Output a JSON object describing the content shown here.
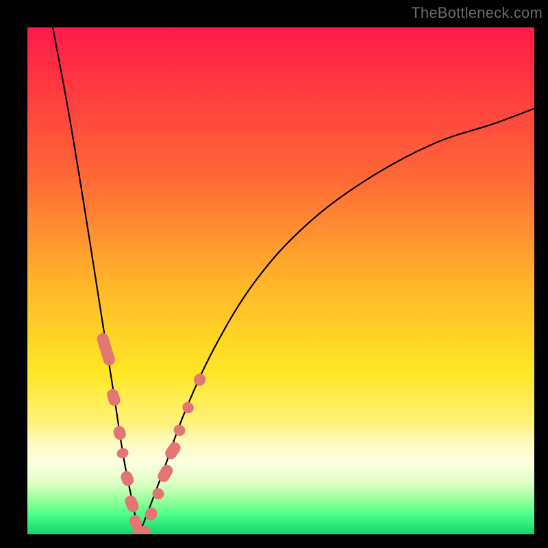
{
  "watermark": "TheBottleneck.com",
  "colors": {
    "curve": "#000000",
    "marker": "#e37575",
    "frame": "#000000"
  },
  "chart_data": {
    "type": "line",
    "title": "",
    "xlabel": "",
    "ylabel": "",
    "xlim": [
      0,
      1
    ],
    "ylim": [
      0,
      1
    ],
    "axes_visible": false,
    "background": "vertical-gradient red→orange→yellow→green",
    "description": "V-shaped bottleneck curve over rainbow gradient; minimum (0 on y) near x≈0.22; pink capsule markers clustered along both arms near the minimum region.",
    "series": [
      {
        "name": "left-arm",
        "x": [
          0.05,
          0.08,
          0.11,
          0.14,
          0.17,
          0.19,
          0.21,
          0.215,
          0.22
        ],
        "y": [
          1.0,
          0.84,
          0.66,
          0.47,
          0.28,
          0.15,
          0.05,
          0.02,
          0.0
        ]
      },
      {
        "name": "right-arm",
        "x": [
          0.22,
          0.24,
          0.27,
          0.31,
          0.37,
          0.45,
          0.55,
          0.67,
          0.8,
          0.92,
          1.0
        ],
        "y": [
          0.0,
          0.05,
          0.13,
          0.24,
          0.37,
          0.5,
          0.61,
          0.7,
          0.77,
          0.81,
          0.84
        ]
      }
    ],
    "markers": [
      {
        "arm": "left",
        "x": 0.155,
        "y": 0.365,
        "len": 0.06,
        "angle": 73
      },
      {
        "arm": "left",
        "x": 0.17,
        "y": 0.27,
        "len": 0.028,
        "angle": 72
      },
      {
        "arm": "left",
        "x": 0.182,
        "y": 0.2,
        "len": 0.022,
        "angle": 71
      },
      {
        "arm": "left",
        "x": 0.188,
        "y": 0.16,
        "len": 0.014,
        "angle": 70
      },
      {
        "arm": "left",
        "x": 0.197,
        "y": 0.11,
        "len": 0.024,
        "angle": 69
      },
      {
        "arm": "left",
        "x": 0.206,
        "y": 0.06,
        "len": 0.028,
        "angle": 67
      },
      {
        "arm": "left",
        "x": 0.213,
        "y": 0.025,
        "len": 0.02,
        "angle": 62
      },
      {
        "arm": "flat",
        "x": 0.225,
        "y": 0.005,
        "len": 0.03,
        "angle": 0
      },
      {
        "arm": "right",
        "x": 0.244,
        "y": 0.04,
        "len": 0.02,
        "angle": -63
      },
      {
        "arm": "right",
        "x": 0.258,
        "y": 0.08,
        "len": 0.016,
        "angle": -61
      },
      {
        "arm": "right",
        "x": 0.272,
        "y": 0.12,
        "len": 0.03,
        "angle": -59
      },
      {
        "arm": "right",
        "x": 0.287,
        "y": 0.165,
        "len": 0.03,
        "angle": -56
      },
      {
        "arm": "right",
        "x": 0.3,
        "y": 0.205,
        "len": 0.016,
        "angle": -54
      },
      {
        "arm": "right",
        "x": 0.317,
        "y": 0.25,
        "len": 0.016,
        "angle": -52
      },
      {
        "arm": "right",
        "x": 0.34,
        "y": 0.305,
        "len": 0.018,
        "angle": -49
      }
    ]
  }
}
